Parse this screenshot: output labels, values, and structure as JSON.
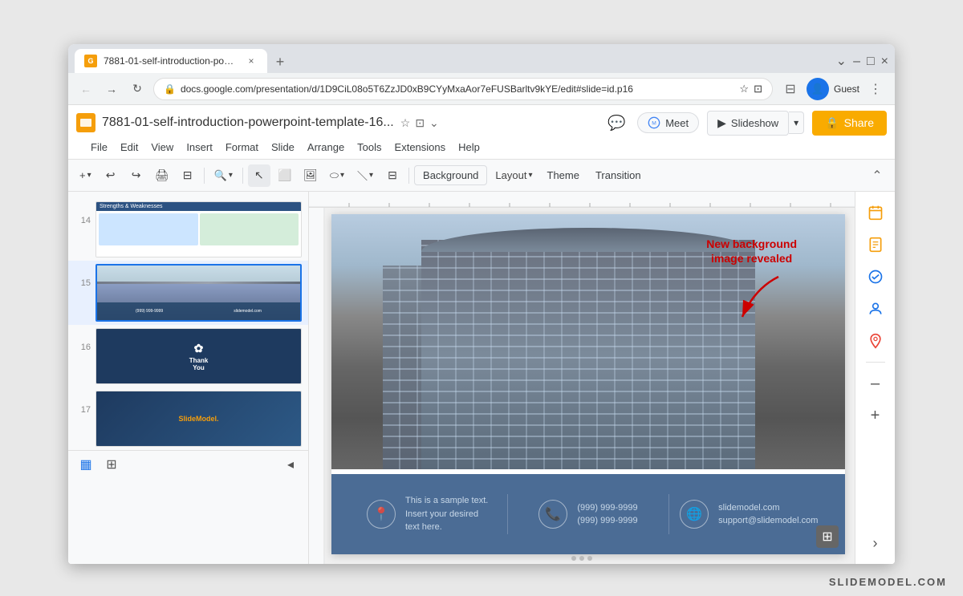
{
  "browser": {
    "tab": {
      "favicon_text": "G",
      "title": "7881-01-self-introduction-powe...",
      "close_label": "×",
      "new_tab_label": "+"
    },
    "window_controls": {
      "minimize": "–",
      "maximize": "□",
      "close": "×"
    },
    "addressbar": {
      "back_icon": "←",
      "forward_icon": "→",
      "refresh_icon": "↻",
      "lock_icon": "🔒",
      "url": "docs.google.com/presentation/d/1D9CiL08o5T6ZzJD0xB9CYyMxaAor7eFUSBarltv9kYE/edit#slide=id.p16",
      "bookmark_icon": "☆",
      "screenshot_icon": "⊡",
      "more_icon": "⋮",
      "profile_label": "Guest"
    }
  },
  "app": {
    "logo_color": "#f59e0b",
    "filename": "7881-01-self-introduction-powerpoint-template-16...",
    "filename_icons": [
      "☆",
      "⊡",
      "⌄"
    ],
    "menu": [
      "File",
      "Edit",
      "View",
      "Insert",
      "Format",
      "Slide",
      "Arrange",
      "Tools",
      "Extensions",
      "Help"
    ],
    "header_right": {
      "chat_icon": "💬",
      "meet_label": "Meet",
      "slideshow_label": "Slideshow",
      "slideshow_dropdown": "▾",
      "share_icon": "🔒",
      "share_label": "Share"
    },
    "toolbar": {
      "buttons": [
        "+",
        "▾",
        "↩",
        "↪",
        "🖨",
        "⊟",
        "🔍",
        "▾",
        "↖",
        "⬜",
        "⊡",
        "⬭",
        "＼",
        "▾",
        "⊟"
      ],
      "background_label": "Background",
      "layout_label": "Layout",
      "layout_dropdown": "▾",
      "theme_label": "Theme",
      "transition_label": "Transition",
      "collapse_icon": "⌃"
    },
    "sidebar": {
      "slides": [
        {
          "number": "14",
          "type": "strengths-weaknesses"
        },
        {
          "number": "15",
          "type": "building-contact",
          "active": true
        },
        {
          "number": "16",
          "type": "thank-you"
        },
        {
          "number": "17",
          "type": "logo-slide"
        }
      ]
    },
    "slide": {
      "annotation_text": "New background\nimage revealed",
      "bottom_bar": {
        "item1_text": "This is a sample text.\nInsert your desired\ntext here.",
        "item2_phone1": "(999) 999-9999",
        "item2_phone2": "(999) 999-9999",
        "item3_email1": "slidemodel.com",
        "item3_email2": "support@slidemodel.com"
      }
    },
    "bottom_toolbar": {
      "grid_icon": "⊞",
      "list_icon": "▦",
      "collapse_icon": "⌃"
    },
    "right_sidebar": {
      "calendar_icon": "📅",
      "notes_icon": "📋",
      "tasks_icon": "✓",
      "contacts_icon": "👤",
      "maps_icon": "📍",
      "zoom_in": "+",
      "zoom_out": "–"
    }
  },
  "watermark": {
    "text": "SLIDEMODEL.COM"
  }
}
